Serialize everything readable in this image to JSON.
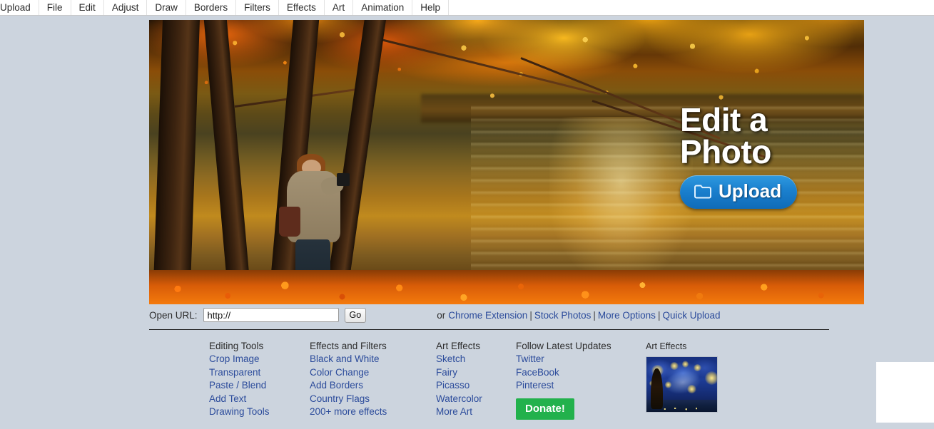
{
  "menubar": {
    "items": [
      {
        "label": "Upload"
      },
      {
        "label": "File"
      },
      {
        "label": "Edit"
      },
      {
        "label": "Adjust"
      },
      {
        "label": "Draw"
      },
      {
        "label": "Borders"
      },
      {
        "label": "Filters"
      },
      {
        "label": "Effects"
      },
      {
        "label": "Art"
      },
      {
        "label": "Animation"
      },
      {
        "label": "Help"
      }
    ]
  },
  "hero": {
    "title": "Edit a\nPhoto",
    "upload_label": "Upload",
    "upload_icon": "folder-icon",
    "image_alt": "Photographer in autumn forest beside a lake with golden foliage"
  },
  "url_bar": {
    "label": "Open URL:",
    "value": "http://",
    "placeholder": "http://",
    "go_label": "Go",
    "or_text": "or",
    "links": [
      {
        "label": "Chrome Extension"
      },
      {
        "label": "Stock Photos"
      },
      {
        "label": "More Options"
      },
      {
        "label": "Quick Upload"
      }
    ],
    "separator": "|"
  },
  "footer": {
    "columns": [
      {
        "heading": "Editing Tools",
        "links": [
          "Crop Image",
          "Transparent",
          "Paste / Blend",
          "Add Text",
          "Drawing Tools"
        ]
      },
      {
        "heading": "Effects and Filters",
        "links": [
          "Black and White",
          "Color Change",
          "Add Borders",
          "Country Flags",
          "200+ more effects"
        ]
      },
      {
        "heading": "Art Effects",
        "links": [
          "Sketch",
          "Fairy",
          "Picasso",
          "Watercolor",
          "More Art"
        ]
      },
      {
        "heading": "Follow Latest Updates",
        "links": [
          "Twitter",
          "FaceBook",
          "Pinterest"
        ],
        "donate_label": "Donate!"
      }
    ],
    "art_panel": {
      "heading": "Art Effects",
      "thumbnail_alt": "Starry Night painting thumbnail"
    }
  },
  "colors": {
    "page_background": "#ccd4de",
    "menubar_background": "#ffffff",
    "link": "#2b4b9b",
    "upload_button": "#1b81cf",
    "donate_button": "#22b14c",
    "divider": "#1c1c1c"
  }
}
